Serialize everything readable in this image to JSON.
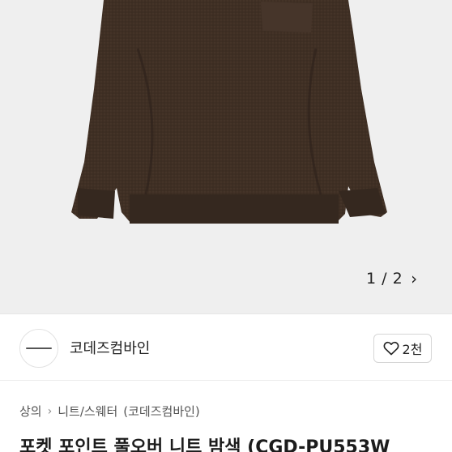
{
  "gallery": {
    "pager_text": "1 / 2"
  },
  "seller": {
    "name": "코데즈컴바인",
    "likes_label": "2천"
  },
  "breadcrumb": {
    "items": [
      "상의",
      "니트/스웨터",
      "(코데즈컴바인)"
    ]
  },
  "product": {
    "title": "포켓 포인트 풀오버 니트 밤색 (CGD-PU553W"
  },
  "colors": {
    "sweater": "#3f2f24",
    "background": "#efefef"
  }
}
